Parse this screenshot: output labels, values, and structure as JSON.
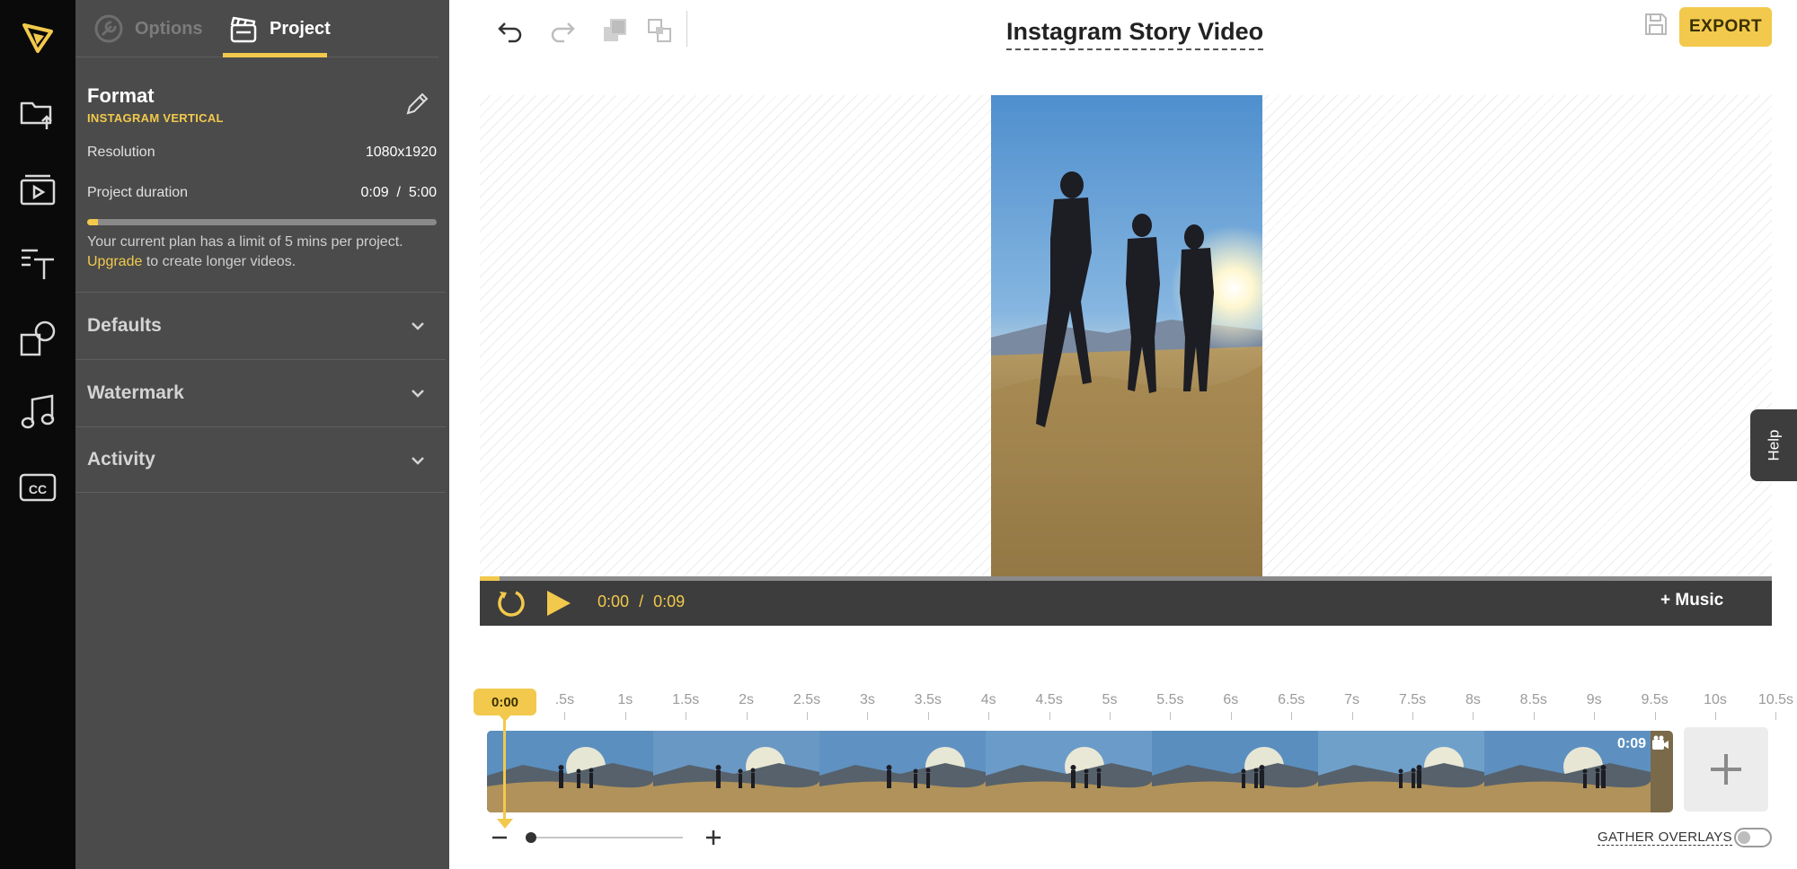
{
  "rail": {
    "items": [
      {
        "icon": "logo-icon"
      },
      {
        "icon": "folder-upload-icon"
      },
      {
        "icon": "media-library-icon"
      },
      {
        "icon": "text-icon"
      },
      {
        "icon": "shapes-icon"
      },
      {
        "icon": "music-note-icon"
      },
      {
        "icon": "closed-captions-icon"
      }
    ]
  },
  "panel": {
    "tabs": [
      {
        "label": "Options",
        "icon": "wrench-icon",
        "active": false
      },
      {
        "label": "Project",
        "icon": "clapperboard-icon",
        "active": true
      }
    ],
    "format": {
      "title": "Format",
      "subtitle": "INSTAGRAM VERTICAL"
    },
    "resolution": {
      "label": "Resolution",
      "value": "1080x1920"
    },
    "duration": {
      "label": "Project duration",
      "value": "0:09  /  5:00",
      "progress_fraction": 0.03
    },
    "plan_note": {
      "text": "Your current plan has a limit of 5 mins per project.",
      "link": "Upgrade",
      "suffix": " to create longer videos."
    },
    "sections": [
      "Defaults",
      "Watermark",
      "Activity"
    ]
  },
  "toolbar": {
    "buttons": [
      "undo-icon",
      "redo-icon",
      "bring-forward-icon",
      "send-backward-icon"
    ],
    "project_title": "Instagram Story Video",
    "export_label": "EXPORT"
  },
  "player": {
    "current": "0:00",
    "separator": "/",
    "total": "0:09",
    "music_label": "+ Music",
    "progress_fraction": 0.015
  },
  "help_label": "Help",
  "timeline": {
    "playhead": "0:00",
    "ticks": [
      ".5s",
      "1s",
      "1.5s",
      "2s",
      "2.5s",
      "3s",
      "3.5s",
      "4s",
      "4.5s",
      "5s",
      "5.5s",
      "6s",
      "6.5s",
      "7s",
      "7.5s",
      "8s",
      "8.5s",
      "9s",
      "9.5s",
      "10s",
      "10.5s"
    ],
    "clip_duration": "0:09",
    "gather_label": "GATHER OVERLAYS",
    "gather_on": false
  },
  "colors": {
    "accent": "#f2c94c",
    "rail": "#0a0a0a",
    "panel": "#4b4b4b",
    "player": "#3d3d3d"
  }
}
